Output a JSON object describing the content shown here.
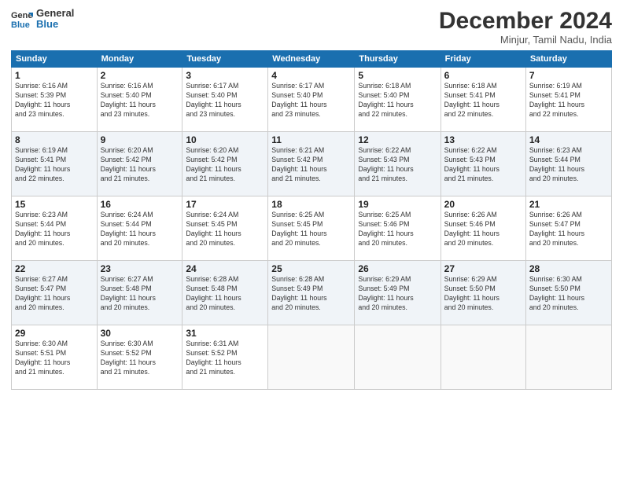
{
  "header": {
    "logo_line1": "General",
    "logo_line2": "Blue",
    "month": "December 2024",
    "location": "Minjur, Tamil Nadu, India"
  },
  "weekdays": [
    "Sunday",
    "Monday",
    "Tuesday",
    "Wednesday",
    "Thursday",
    "Friday",
    "Saturday"
  ],
  "weeks": [
    [
      {
        "day": "1",
        "info": "Sunrise: 6:16 AM\nSunset: 5:39 PM\nDaylight: 11 hours\nand 23 minutes."
      },
      {
        "day": "2",
        "info": "Sunrise: 6:16 AM\nSunset: 5:40 PM\nDaylight: 11 hours\nand 23 minutes."
      },
      {
        "day": "3",
        "info": "Sunrise: 6:17 AM\nSunset: 5:40 PM\nDaylight: 11 hours\nand 23 minutes."
      },
      {
        "day": "4",
        "info": "Sunrise: 6:17 AM\nSunset: 5:40 PM\nDaylight: 11 hours\nand 23 minutes."
      },
      {
        "day": "5",
        "info": "Sunrise: 6:18 AM\nSunset: 5:40 PM\nDaylight: 11 hours\nand 22 minutes."
      },
      {
        "day": "6",
        "info": "Sunrise: 6:18 AM\nSunset: 5:41 PM\nDaylight: 11 hours\nand 22 minutes."
      },
      {
        "day": "7",
        "info": "Sunrise: 6:19 AM\nSunset: 5:41 PM\nDaylight: 11 hours\nand 22 minutes."
      }
    ],
    [
      {
        "day": "8",
        "info": "Sunrise: 6:19 AM\nSunset: 5:41 PM\nDaylight: 11 hours\nand 22 minutes."
      },
      {
        "day": "9",
        "info": "Sunrise: 6:20 AM\nSunset: 5:42 PM\nDaylight: 11 hours\nand 21 minutes."
      },
      {
        "day": "10",
        "info": "Sunrise: 6:20 AM\nSunset: 5:42 PM\nDaylight: 11 hours\nand 21 minutes."
      },
      {
        "day": "11",
        "info": "Sunrise: 6:21 AM\nSunset: 5:42 PM\nDaylight: 11 hours\nand 21 minutes."
      },
      {
        "day": "12",
        "info": "Sunrise: 6:22 AM\nSunset: 5:43 PM\nDaylight: 11 hours\nand 21 minutes."
      },
      {
        "day": "13",
        "info": "Sunrise: 6:22 AM\nSunset: 5:43 PM\nDaylight: 11 hours\nand 21 minutes."
      },
      {
        "day": "14",
        "info": "Sunrise: 6:23 AM\nSunset: 5:44 PM\nDaylight: 11 hours\nand 20 minutes."
      }
    ],
    [
      {
        "day": "15",
        "info": "Sunrise: 6:23 AM\nSunset: 5:44 PM\nDaylight: 11 hours\nand 20 minutes."
      },
      {
        "day": "16",
        "info": "Sunrise: 6:24 AM\nSunset: 5:44 PM\nDaylight: 11 hours\nand 20 minutes."
      },
      {
        "day": "17",
        "info": "Sunrise: 6:24 AM\nSunset: 5:45 PM\nDaylight: 11 hours\nand 20 minutes."
      },
      {
        "day": "18",
        "info": "Sunrise: 6:25 AM\nSunset: 5:45 PM\nDaylight: 11 hours\nand 20 minutes."
      },
      {
        "day": "19",
        "info": "Sunrise: 6:25 AM\nSunset: 5:46 PM\nDaylight: 11 hours\nand 20 minutes."
      },
      {
        "day": "20",
        "info": "Sunrise: 6:26 AM\nSunset: 5:46 PM\nDaylight: 11 hours\nand 20 minutes."
      },
      {
        "day": "21",
        "info": "Sunrise: 6:26 AM\nSunset: 5:47 PM\nDaylight: 11 hours\nand 20 minutes."
      }
    ],
    [
      {
        "day": "22",
        "info": "Sunrise: 6:27 AM\nSunset: 5:47 PM\nDaylight: 11 hours\nand 20 minutes."
      },
      {
        "day": "23",
        "info": "Sunrise: 6:27 AM\nSunset: 5:48 PM\nDaylight: 11 hours\nand 20 minutes."
      },
      {
        "day": "24",
        "info": "Sunrise: 6:28 AM\nSunset: 5:48 PM\nDaylight: 11 hours\nand 20 minutes."
      },
      {
        "day": "25",
        "info": "Sunrise: 6:28 AM\nSunset: 5:49 PM\nDaylight: 11 hours\nand 20 minutes."
      },
      {
        "day": "26",
        "info": "Sunrise: 6:29 AM\nSunset: 5:49 PM\nDaylight: 11 hours\nand 20 minutes."
      },
      {
        "day": "27",
        "info": "Sunrise: 6:29 AM\nSunset: 5:50 PM\nDaylight: 11 hours\nand 20 minutes."
      },
      {
        "day": "28",
        "info": "Sunrise: 6:30 AM\nSunset: 5:50 PM\nDaylight: 11 hours\nand 20 minutes."
      }
    ],
    [
      {
        "day": "29",
        "info": "Sunrise: 6:30 AM\nSunset: 5:51 PM\nDaylight: 11 hours\nand 21 minutes."
      },
      {
        "day": "30",
        "info": "Sunrise: 6:30 AM\nSunset: 5:52 PM\nDaylight: 11 hours\nand 21 minutes."
      },
      {
        "day": "31",
        "info": "Sunrise: 6:31 AM\nSunset: 5:52 PM\nDaylight: 11 hours\nand 21 minutes."
      },
      null,
      null,
      null,
      null
    ]
  ]
}
